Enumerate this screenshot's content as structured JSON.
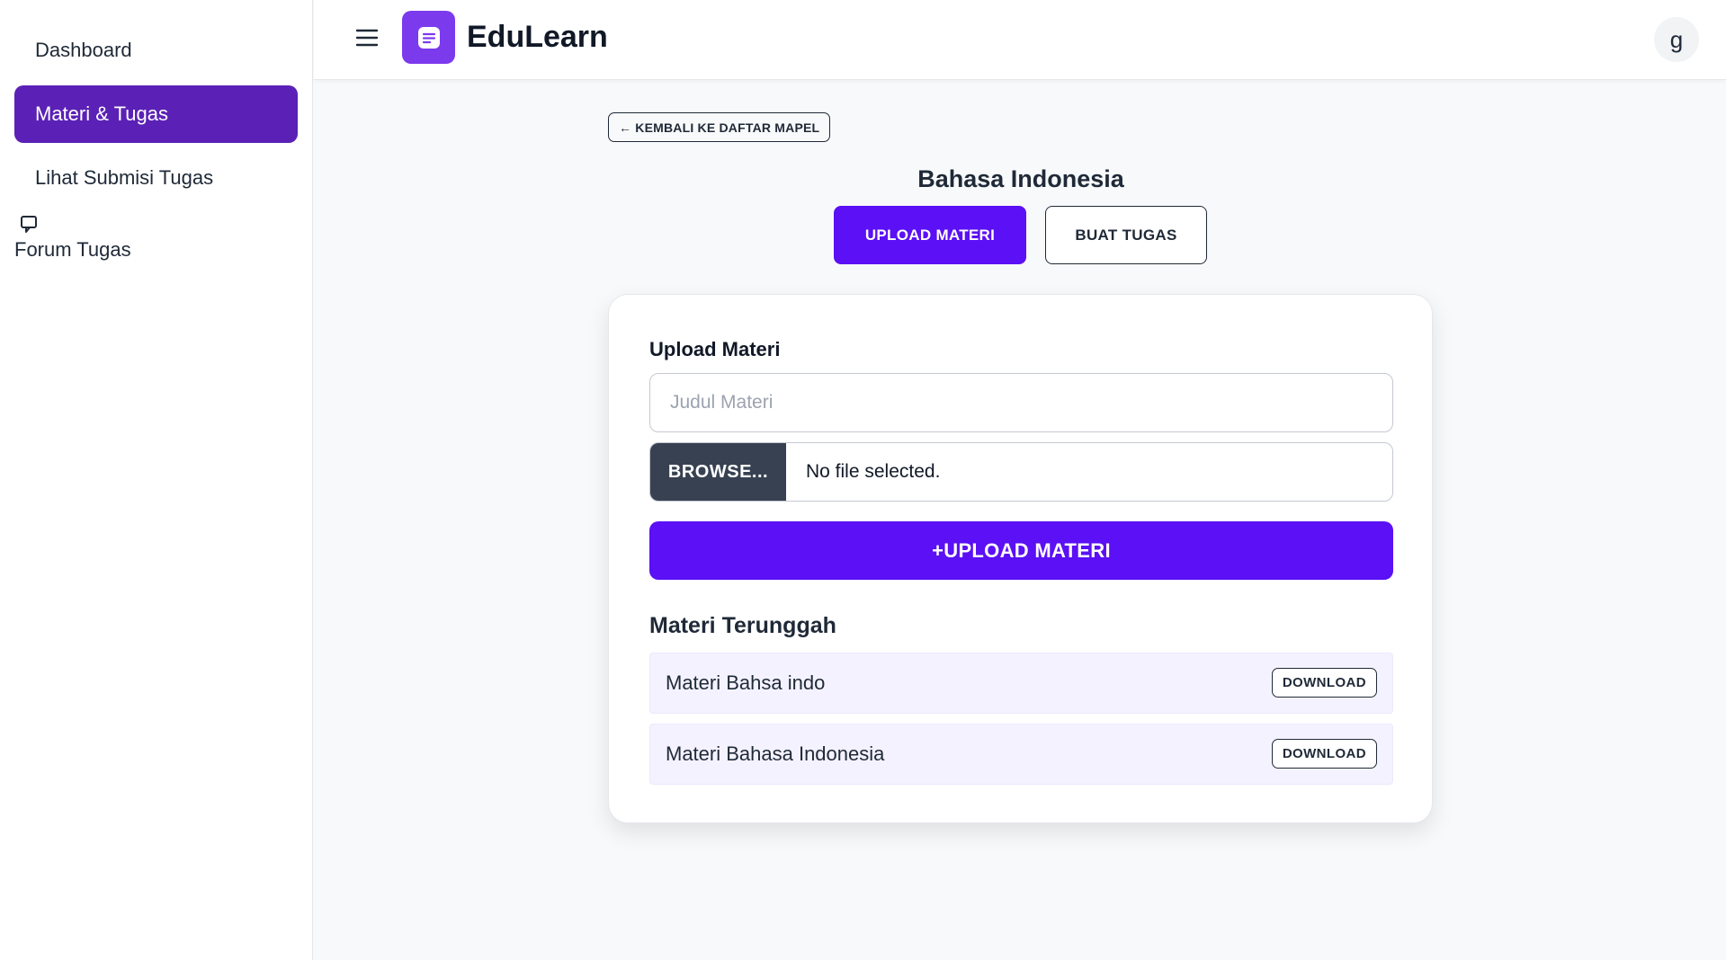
{
  "sidebar": {
    "items": [
      {
        "label": "Dashboard"
      },
      {
        "label": "Materi & Tugas"
      },
      {
        "label": "Lihat Submisi Tugas"
      }
    ],
    "forum": {
      "label": "Forum Tugas",
      "icon": "chat-bubble-icon"
    }
  },
  "header": {
    "brand": "EduLearn",
    "avatar_initial": "g",
    "menu_icon": "hamburger-menu-icon",
    "logo_icon": "document-icon",
    "logo_color": "#7c3aed"
  },
  "main": {
    "back_label": "← KEMBALI KE DAFTAR MAPEL",
    "subject_title": "Bahasa Indonesia",
    "tabs": [
      {
        "label": "UPLOAD MATERI"
      },
      {
        "label": "BUAT TUGAS"
      }
    ],
    "form": {
      "title": "Upload Materi",
      "title_placeholder": "Judul Materi",
      "title_value": "",
      "browse_label": "BROWSE...",
      "file_status": "No file selected.",
      "submit_label": "+UPLOAD MATERI"
    },
    "uploaded": {
      "title": "Materi Terunggah",
      "items": [
        {
          "name": "Materi Bahsa indo",
          "action": "DOWNLOAD"
        },
        {
          "name": "Materi Bahasa Indonesia",
          "action": "DOWNLOAD"
        }
      ]
    }
  },
  "colors": {
    "accent": "#5b10f5",
    "sidebar_active": "#5b21b6",
    "dark": "#374151"
  }
}
